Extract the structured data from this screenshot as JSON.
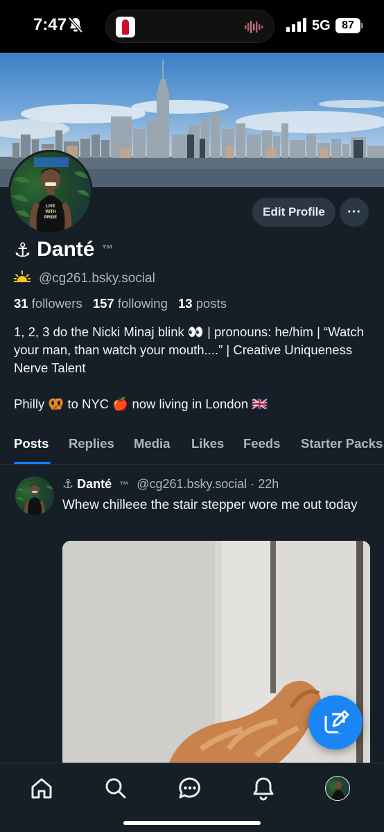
{
  "status_bar": {
    "time": "7:47",
    "network": "5G",
    "battery": "87"
  },
  "profile": {
    "display_name_prefix": "⚓",
    "display_name": "Danté",
    "display_name_suffix": "™",
    "handle_emoji": "🌅",
    "handle": "@cg261.bsky.social",
    "followers_count": "31",
    "followers_label": "followers",
    "following_count": "157",
    "following_label": "following",
    "posts_count": "13",
    "posts_label": "posts",
    "bio_line1": "1, 2, 3 do the Nicki Minaj blink 👀 | pronouns: he/him | “Watch your man, than watch your mouth....” | Creative Uniqueness Nerve Talent",
    "bio_location": "Philly 🥨 to NYC 🍎 now living in London 🇬🇧",
    "edit_profile_label": "Edit Profile",
    "more_label": "···",
    "avatar_shirt_text": "LIVE WITH PRIDE"
  },
  "tabs": [
    {
      "label": "Posts",
      "active": true
    },
    {
      "label": "Replies",
      "active": false
    },
    {
      "label": "Media",
      "active": false
    },
    {
      "label": "Likes",
      "active": false
    },
    {
      "label": "Feeds",
      "active": false
    },
    {
      "label": "Starter Packs",
      "active": false
    }
  ],
  "post": {
    "author_prefix": "⚓",
    "author": "Danté",
    "author_suffix": "™",
    "handle": "@cg261.bsky.social",
    "separator": "·",
    "time": "22h",
    "text": "Whew chilleee the stair stepper wore me out today"
  },
  "nav": {
    "icons": [
      "home-icon",
      "search-icon",
      "chat-icon",
      "bell-icon",
      "profile-avatar"
    ]
  },
  "colors": {
    "background": "#161e27",
    "accent": "#1083fe",
    "fab": "#1a85f5",
    "button_bg": "#2b3744",
    "muted_text": "#aab6c2"
  }
}
